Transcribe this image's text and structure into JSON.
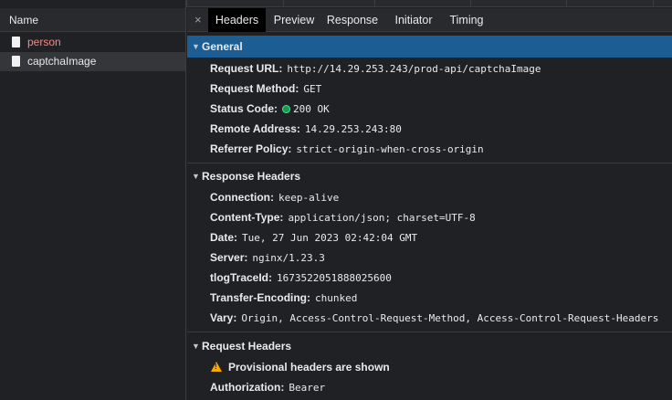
{
  "requests_pane": {
    "column_header": "Name",
    "items": [
      {
        "name": "person",
        "color": "#f28b82"
      },
      {
        "name": "captchaImage",
        "color": "#e8eaed",
        "selected": true
      }
    ]
  },
  "tabs": {
    "close_glyph": "×",
    "items": [
      "Headers",
      "Preview",
      "Response",
      "Initiator",
      "Timing"
    ],
    "active": "Headers"
  },
  "general": {
    "title": "General",
    "request_url": {
      "key": "Request URL:",
      "value": "http://14.29.253.243/prod-api/captchaImage"
    },
    "request_method": {
      "key": "Request Method:",
      "value": "GET"
    },
    "status_code": {
      "key": "Status Code:",
      "value": "200 OK",
      "dot_color": "#0f9d58"
    },
    "remote_address": {
      "key": "Remote Address:",
      "value": "14.29.253.243:80"
    },
    "referrer_policy": {
      "key": "Referrer Policy:",
      "value": "strict-origin-when-cross-origin"
    }
  },
  "response_headers": {
    "title": "Response Headers",
    "items": [
      {
        "key": "Connection:",
        "value": "keep-alive"
      },
      {
        "key": "Content-Type:",
        "value": "application/json; charset=UTF-8"
      },
      {
        "key": "Date:",
        "value": "Tue, 27 Jun 2023 02:42:04 GMT"
      },
      {
        "key": "Server:",
        "value": "nginx/1.23.3"
      },
      {
        "key": "tlogTraceId:",
        "value": "1673522051888025600"
      },
      {
        "key": "Transfer-Encoding:",
        "value": "chunked"
      },
      {
        "key": "Vary:",
        "value": "Origin, Access-Control-Request-Method, Access-Control-Request-Headers"
      }
    ]
  },
  "request_headers": {
    "title": "Request Headers",
    "warning": "Provisional headers are shown",
    "items": [
      {
        "key": "Authorization:",
        "value": "Bearer"
      }
    ]
  },
  "colors": {
    "background": "#202124",
    "selected_section": "#1c5e93",
    "warning": "#f9ab00"
  }
}
